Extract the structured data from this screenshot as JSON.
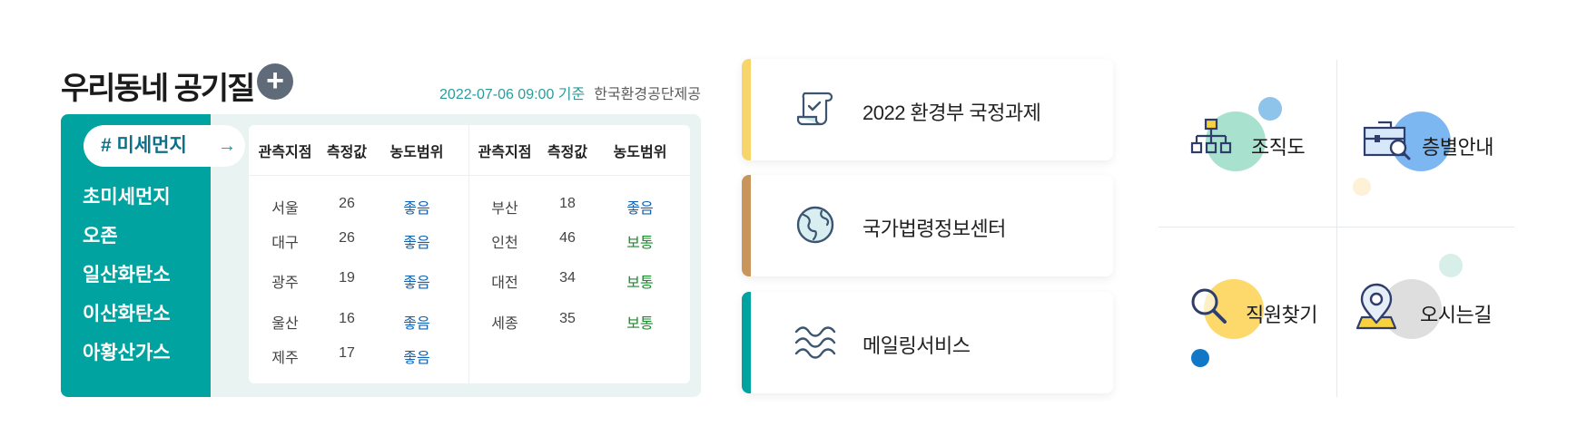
{
  "air": {
    "title": "우리동네 공기질",
    "plus_label": "+",
    "date": "2022-07-06 09:00 기준",
    "source": "한국환경공단제공",
    "tabs": [
      {
        "label": "# 미세먼지",
        "arrow": "→"
      },
      {
        "label": "초미세먼지"
      },
      {
        "label": "오존"
      },
      {
        "label": "일산화탄소"
      },
      {
        "label": "이산화탄소"
      },
      {
        "label": "아황산가스"
      }
    ],
    "headers": [
      "관측지점",
      "측정값",
      "농도범위",
      "관측지점",
      "측정값",
      "농도범위"
    ],
    "left_rows": [
      {
        "place": "서울",
        "value": "26",
        "level": "좋음"
      },
      {
        "place": "대구",
        "value": "26",
        "level": "좋음"
      },
      {
        "place": "광주",
        "value": "19",
        "level": "좋음"
      },
      {
        "place": "울산",
        "value": "16",
        "level": "좋음"
      },
      {
        "place": "제주",
        "value": "17",
        "level": "좋음"
      }
    ],
    "right_rows": [
      {
        "place": "부산",
        "value": "18",
        "level": "좋음"
      },
      {
        "place": "인천",
        "value": "46",
        "level": "보통"
      },
      {
        "place": "대전",
        "value": "34",
        "level": "보통"
      },
      {
        "place": "세종",
        "value": "35",
        "level": "보통"
      }
    ],
    "colors": {
      "accent": "#00a3a0",
      "good": "#1261b0",
      "normal": "#1a8a2b"
    }
  },
  "cards": [
    {
      "label": "2022 환경부 국정과제",
      "icon": "scroll-check-icon",
      "bar_color": "#f7d56b"
    },
    {
      "label": "국가법령정보센터",
      "icon": "globe-icon",
      "bar_color": "#c9955a"
    },
    {
      "label": "메일링서비스",
      "icon": "waves-icon",
      "bar_color": "#00a3a0"
    }
  ],
  "quick_menu": [
    {
      "label": "조직도",
      "icon": "org-chart-icon"
    },
    {
      "label": "층별안내",
      "icon": "floor-guide-icon"
    },
    {
      "label": "직원찾기",
      "icon": "magnifier-icon"
    },
    {
      "label": "오시는길",
      "icon": "map-pin-icon"
    }
  ]
}
